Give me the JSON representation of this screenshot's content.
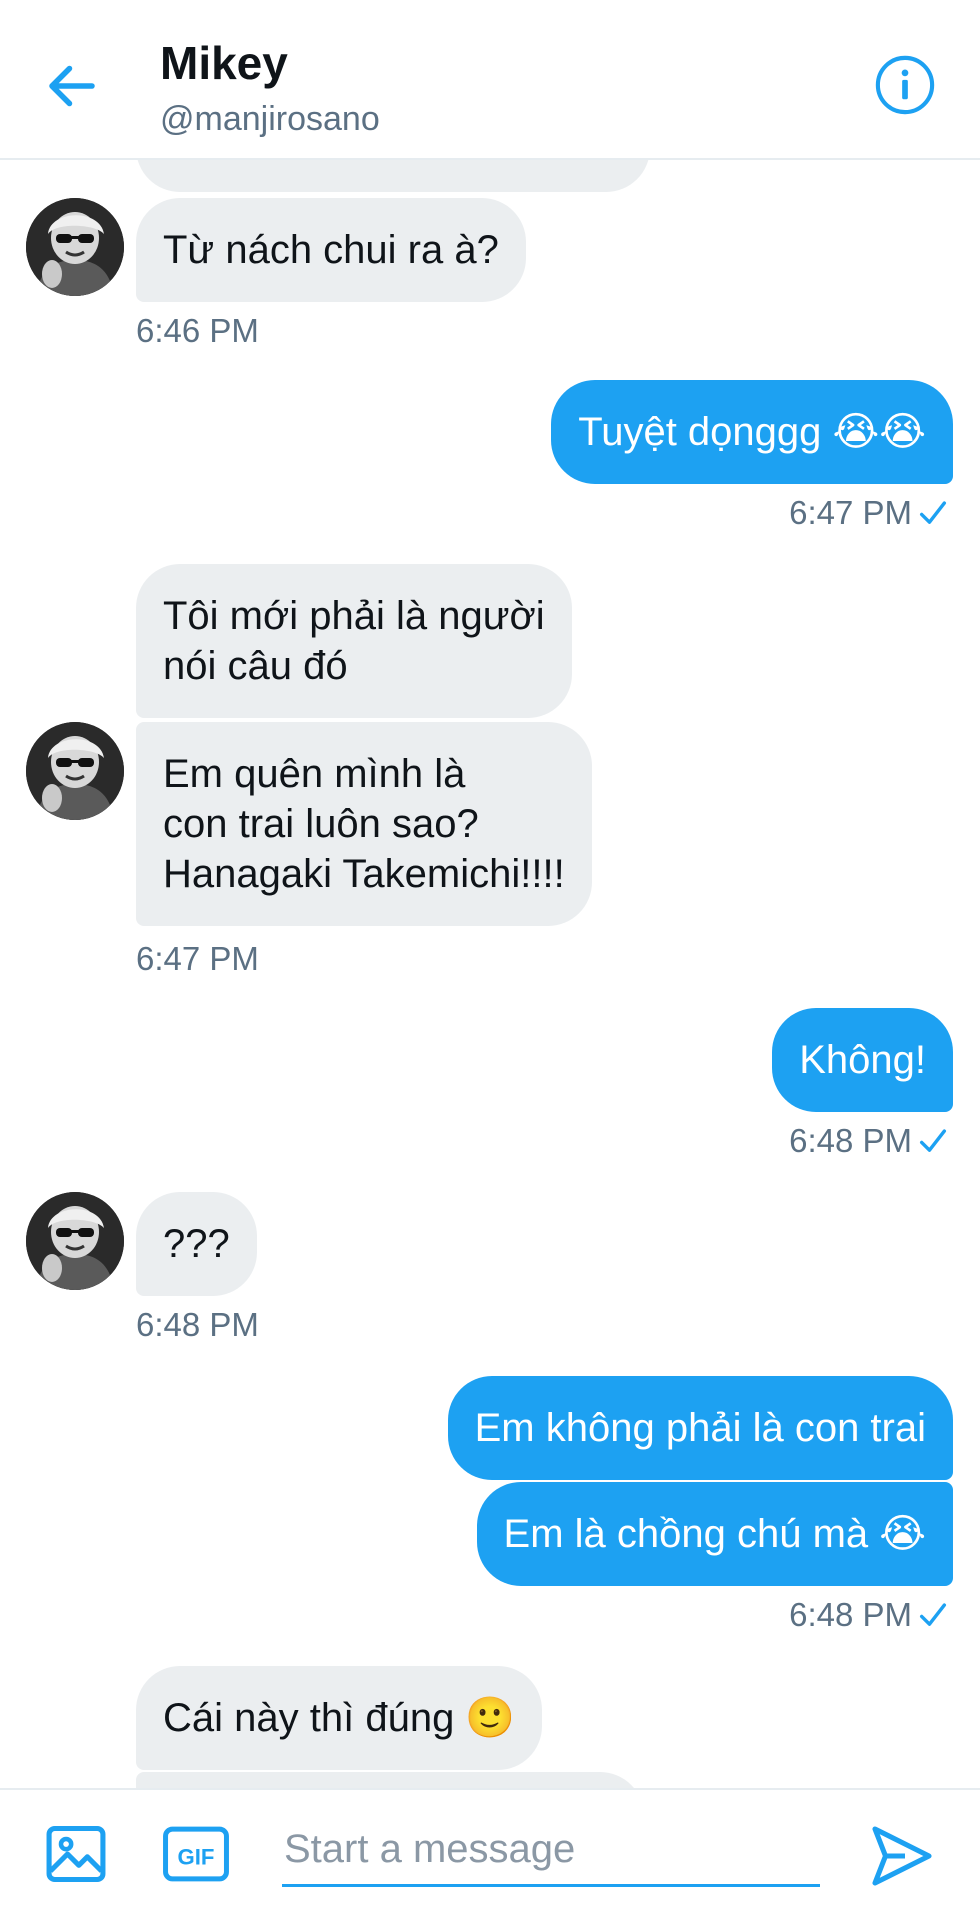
{
  "header": {
    "title": "Mikey",
    "handle": "@manjirosano",
    "back_icon": "arrow-left-icon",
    "info_icon": "info-icon"
  },
  "messages": [
    {
      "side": "in",
      "text": "Từ nách chui ra à?"
    },
    {
      "side": "in",
      "time": "6:46 PM"
    },
    {
      "side": "out",
      "text": "Tuyệt dọnggg 😭😭"
    },
    {
      "side": "out",
      "time": "6:47 PM"
    },
    {
      "side": "in",
      "text": "Tôi mới phải là người\nnói câu đó"
    },
    {
      "side": "in",
      "text": "Em quên mình là\ncon trai luôn sao?\nHanagaki Takemichi!!!!"
    },
    {
      "side": "in",
      "time": "6:47 PM"
    },
    {
      "side": "out",
      "text": "Không!"
    },
    {
      "side": "out",
      "time": "6:48 PM"
    },
    {
      "side": "in",
      "text": "???"
    },
    {
      "side": "in",
      "time": "6:48 PM"
    },
    {
      "side": "out",
      "text": "Em không phải là con trai"
    },
    {
      "side": "out",
      "text": "Em là chồng chú mà 😭"
    },
    {
      "side": "out",
      "time": "6:48 PM"
    },
    {
      "side": "in",
      "text": "Cái này thì đúng 🙂"
    }
  ],
  "composer": {
    "placeholder": "Start a message",
    "media_icon": "image-icon",
    "gif_icon": "gif-icon",
    "gif_label": "GIF",
    "send_icon": "send-icon"
  },
  "colors": {
    "accent": "#1da1f2",
    "incoming_bubble": "#ebeef0",
    "secondary_text": "#5b7083"
  }
}
